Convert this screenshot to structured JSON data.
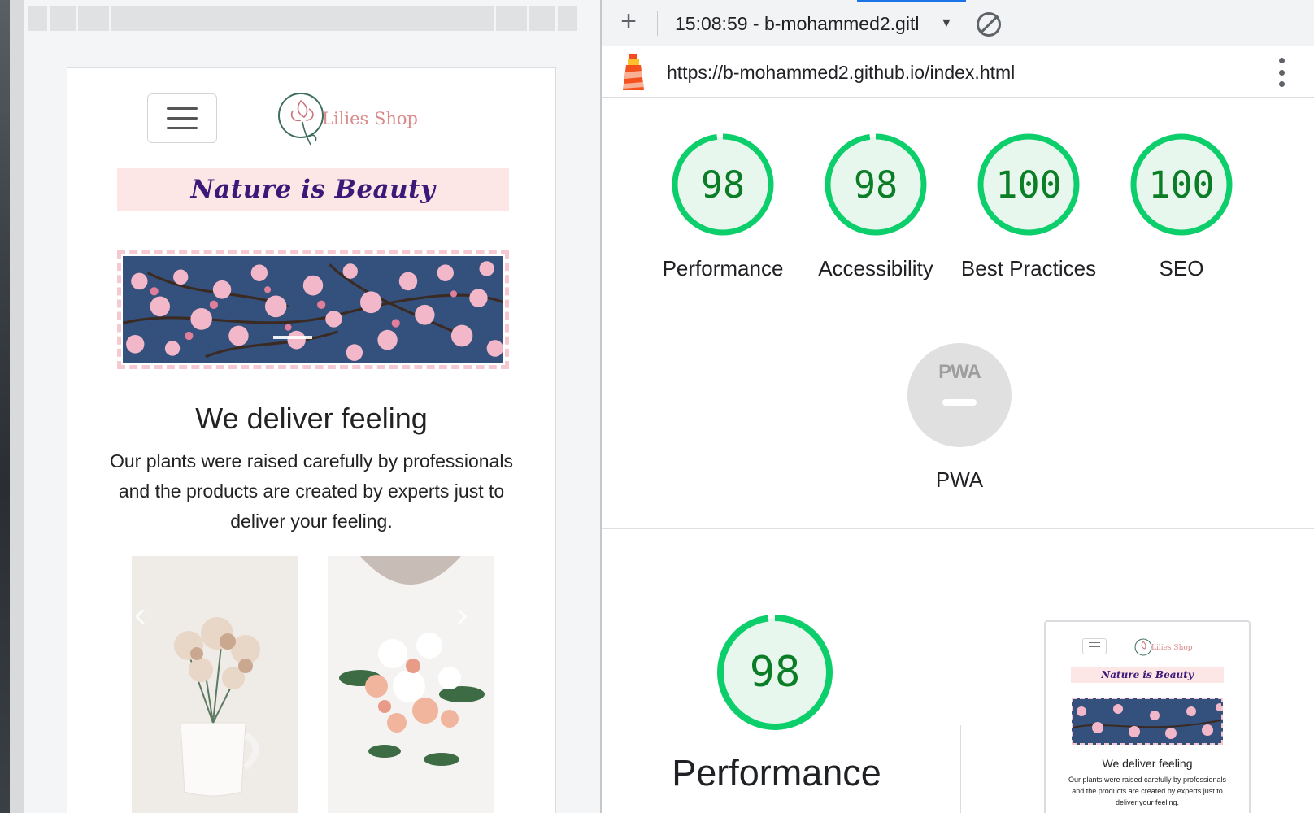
{
  "site": {
    "logo_text": "Lilies Shop",
    "tagline": "Nature is Beauty",
    "section_title": "We deliver feeling",
    "section_text": "Our plants were raised carefully by professionals and the products are created by experts just to deliver your feeling.",
    "carousel_prev": "‹",
    "carousel_next": "›"
  },
  "lighthouse": {
    "report_selector": "15:08:59 - b-mohammed2.gitl",
    "url": "https://b-mohammed2.github.io/index.html",
    "scores": [
      {
        "label": "Performance",
        "value": "98",
        "score": 0.98
      },
      {
        "label": "Accessibility",
        "value": "98",
        "score": 0.98
      },
      {
        "label": "Best Practices",
        "value": "100",
        "score": 1.0
      },
      {
        "label": "SEO",
        "value": "100",
        "score": 1.0
      }
    ],
    "pwa": {
      "label": "PWA",
      "mark": "PWA"
    },
    "detail": {
      "title": "Performance",
      "value": "98",
      "score": 0.98
    }
  },
  "colors": {
    "pass_green": "#0cce6b",
    "pass_fill": "#e8f7ed",
    "pass_text": "#0b7d26",
    "tagline_bg": "#fde6e6",
    "tagline_text": "#3a1a78",
    "logo_pink": "#d98b8b",
    "accent_blue": "#1a73e8"
  },
  "icons": {
    "new_report": "plus-icon",
    "clear": "clear-icon",
    "more": "kebab-icon",
    "lighthouse": "lighthouse-icon",
    "menu": "hamburger-icon"
  }
}
